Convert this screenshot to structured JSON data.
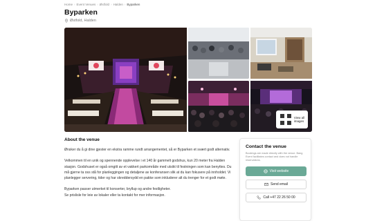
{
  "breadcrumb": [
    {
      "label": "Home"
    },
    {
      "label": "Event Venues"
    },
    {
      "label": "Østfold"
    },
    {
      "label": "Halden"
    },
    {
      "label": "Byparken",
      "current": true
    }
  ],
  "venue": {
    "name": "Byparken",
    "location": "Østfold, Halden"
  },
  "gallery": {
    "view_all_label": "View all images"
  },
  "about": {
    "heading": "About the venue",
    "paragraphs": [
      "Ønsker du å gi dine gjester en ekstra ramme rundt arrangementet, så er Byparken et svært godt alternativ.",
      "Velkommen til en unik og spennende opplevelse i et 140 år gammelt godshus, kun 20 meter fra Halden stasjon. Godshuset er også omgitt av et vakkert parkområde med utsikt til festningen som kan benyttes. Du må gjerne ta oss stå for planleggingen og detaljene av konferansen slik at du kan fokusere på innholdet. Vi planlegger servering, tider og har skreddersydd en pakke som inkluderer alt du trenger for et godt møte.",
      "Byparken passer utmerket til konserter, bryllup og andre festligheter.",
      "Se prislisle for leie av lokaler eller ta kontakt for mer informasjon."
    ]
  },
  "contact": {
    "title": "Contact the venue",
    "note": "Bookings are made directly with the venue. Bang Event facilitates contact and does not handle reservations.",
    "website_label": "Visit website",
    "email_label": "Send email",
    "phone_label": "Call +47 22 26 50 00"
  },
  "colors": {
    "primary_button": "#6aa996"
  }
}
